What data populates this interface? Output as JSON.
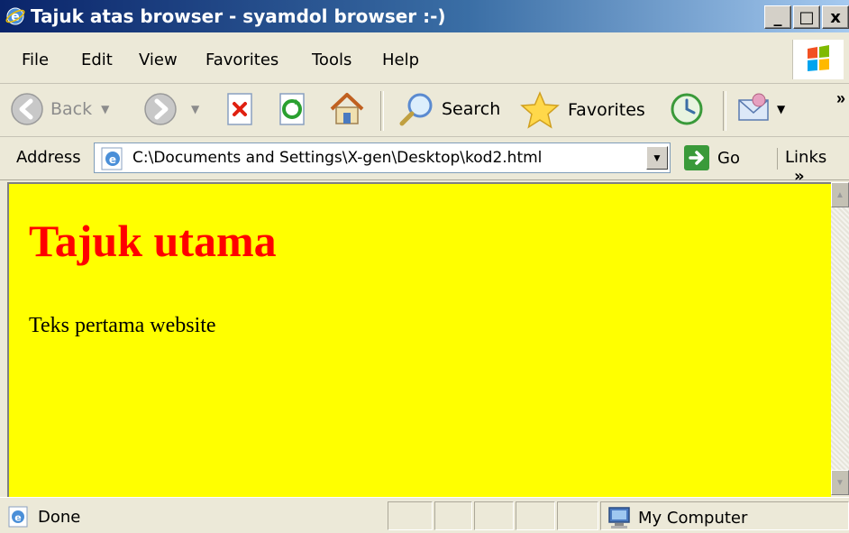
{
  "window": {
    "title": "Tajuk atas browser - syamdol browser :-)",
    "min_label": "_",
    "max_label": "□",
    "close_label": "x"
  },
  "menu": {
    "items": [
      "File",
      "Edit",
      "View",
      "Favorites",
      "Tools",
      "Help"
    ]
  },
  "toolbar": {
    "back_label": "Back",
    "search_label": "Search",
    "favorites_label": "Favorites",
    "chevron": "»"
  },
  "address": {
    "label": "Address",
    "value": "C:\\Documents and Settings\\X-gen\\Desktop\\kod2.html",
    "go_label": "Go",
    "links_label": "Links",
    "chevron": "»"
  },
  "page": {
    "background": "#ffff00",
    "heading": "Tajuk utama",
    "heading_color": "#ff0000",
    "paragraph": "Teks pertama website"
  },
  "status": {
    "text": "Done",
    "zone": "My Computer"
  }
}
